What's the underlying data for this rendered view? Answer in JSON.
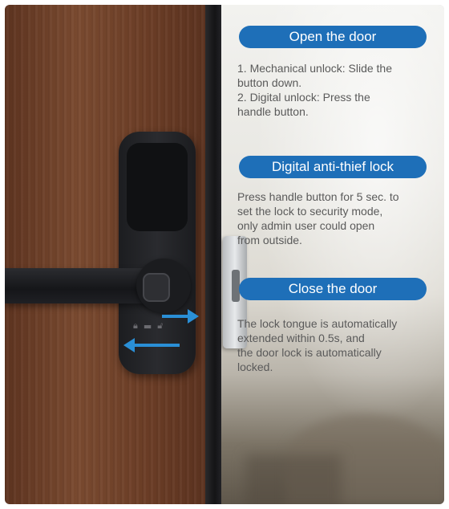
{
  "sections": [
    {
      "title": "Open the door",
      "lines": [
        "1. Mechanical unlock: Slide the",
        "button down.",
        "2. Digital unlock: Press the",
        "handle button."
      ]
    },
    {
      "title": "Digital anti-thief lock",
      "lines": [
        "Press handle button for 5 sec. to",
        "set the lock to security mode,",
        "only admin user could open",
        "from outside."
      ]
    },
    {
      "title": "Close the door",
      "lines": [
        "The lock tongue is automatically",
        "extended within 0.5s, and",
        "the door lock is automatically",
        "locked."
      ]
    }
  ],
  "colors": {
    "pill": "#1e6fb8",
    "arrow": "#2a8fd6",
    "text": "#5a5a5a"
  },
  "icons": [
    "fingerprint-reader-icon",
    "lock-icon",
    "unlock-icon",
    "arrow-right-icon",
    "arrow-left-icon"
  ]
}
